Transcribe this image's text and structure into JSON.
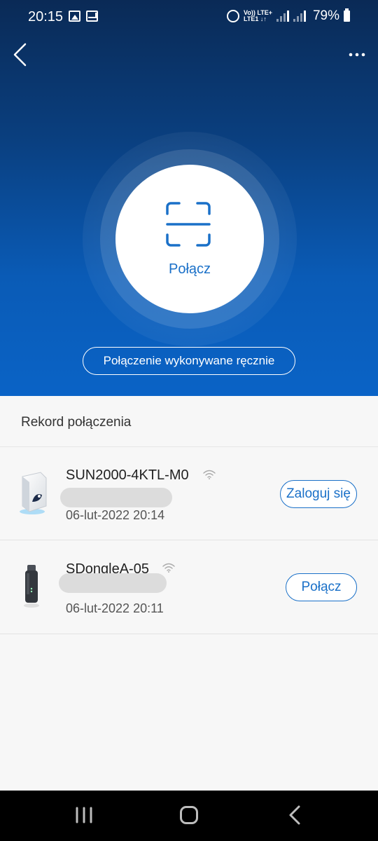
{
  "status_bar": {
    "time": "20:15",
    "network_label": "Vo)) LTE+\nLTE1",
    "battery": "79%"
  },
  "main": {
    "connect_label": "Połącz",
    "manual_button": "Połączenie wykonywane ręcznie"
  },
  "records": {
    "title": "Rekord połączenia",
    "items": [
      {
        "name": "SUN2000-4KTL-M0",
        "date": "06-lut-2022 20:14",
        "action": "Zaloguj się"
      },
      {
        "name": "SDongleA-05",
        "date": "06-lut-2022 20:11",
        "action": "Połącz"
      }
    ]
  },
  "colors": {
    "accent": "#1a70c8",
    "hero_top": "#0a2a56",
    "hero_bottom": "#0a63c6"
  },
  "icons": {
    "back": "chevron-left-icon",
    "more": "more-horizontal-icon",
    "scan": "scan-frame-icon",
    "wifi": "wifi-icon"
  }
}
